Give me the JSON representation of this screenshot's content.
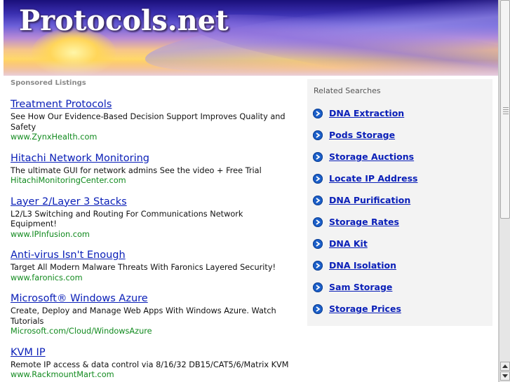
{
  "banner": {
    "title": "Protocols.net"
  },
  "sponsored_label": "Sponsored Listings",
  "listings": [
    {
      "title": "Treatment Protocols",
      "description": "See How Our Evidence-Based Decision Support Improves Quality and Safety",
      "url": "www.ZynxHealth.com"
    },
    {
      "title": "Hitachi Network Monitoring",
      "description": "The ultimate GUI for network admins See the video + Free Trial",
      "url": "HitachiMonitoringCenter.com"
    },
    {
      "title": "Layer 2/Layer 3 Stacks",
      "description": "L2/L3 Switching and Routing For Communications Network Equipment!",
      "url": "www.IPInfusion.com"
    },
    {
      "title": "Anti-virus Isn't Enough",
      "description": "Target All Modern Malware Threats With Faronics Layered Security!",
      "url": "www.faronics.com"
    },
    {
      "title": "Microsoft® Windows Azure",
      "description": "Create, Deploy and Manage Web Apps With Windows Azure. Watch Tutorials",
      "url": "Microsoft.com/Cloud/WindowsAzure"
    },
    {
      "title": "KVM IP",
      "description": "Remote IP access & data control via 8/16/32 DB15/CAT5/6/Matrix KVM",
      "url": "www.RackmountMart.com"
    }
  ],
  "related": {
    "title": "Related Searches",
    "items": [
      "DNA Extraction",
      "Pods Storage",
      "Storage Auctions",
      "Locate IP Address",
      "DNA Purification",
      "Storage Rates",
      "DNA Kit",
      "DNA Isolation",
      "Sam Storage",
      "Storage Prices"
    ]
  },
  "colors": {
    "link": "#0b20b8",
    "url_green": "#118a1e",
    "arrow_blue": "#1b5fc9",
    "related_bg": "#f3f3f3"
  },
  "icons": {
    "related_bullet": "arrow-right-circle-icon",
    "scroll_up": "chevron-up-icon",
    "scroll_down": "chevron-down-icon"
  }
}
